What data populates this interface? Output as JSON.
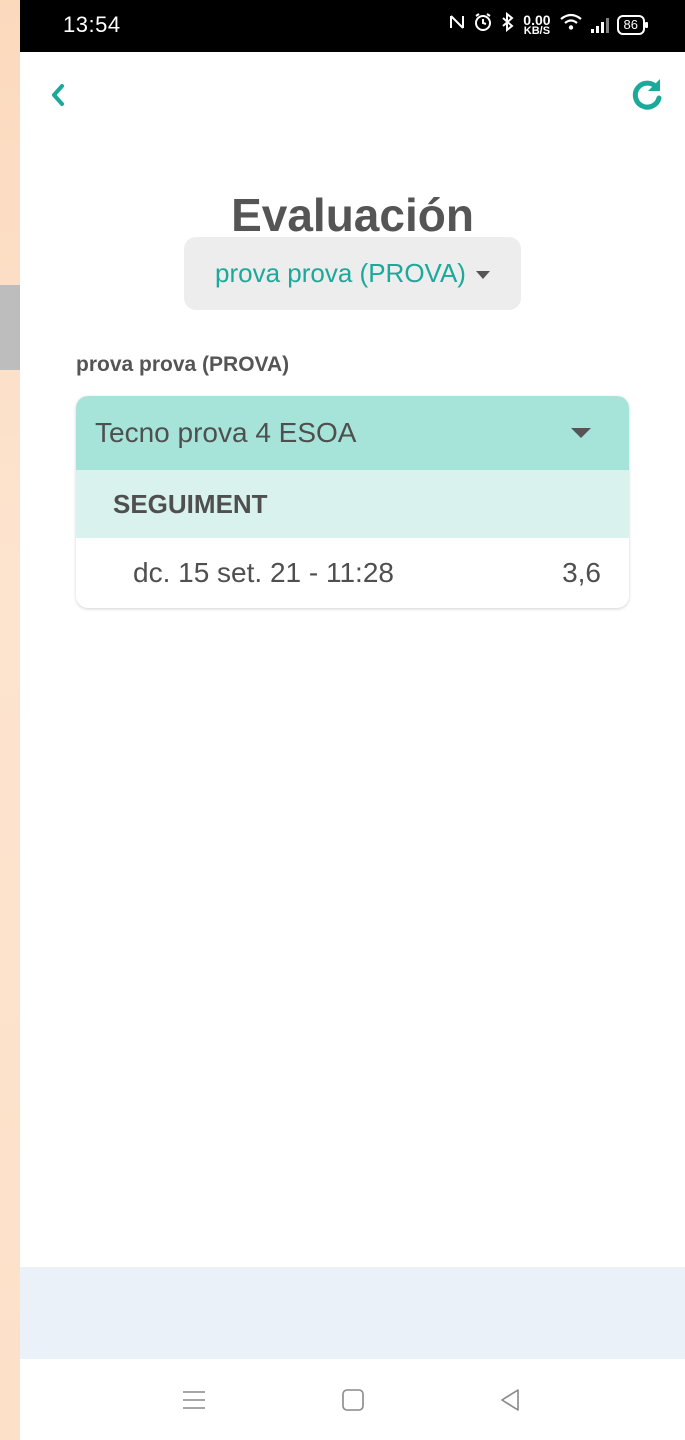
{
  "status_bar": {
    "time": "13:54",
    "icons": [
      "nfc-icon",
      "alarm-icon",
      "bluetooth-icon",
      "network-speed",
      "wifi-icon",
      "signal-icon",
      "battery-icon"
    ],
    "speed_value": "0.00",
    "speed_unit": "KB/S",
    "battery": "86"
  },
  "header": {
    "back_icon": "chevron-left-icon",
    "refresh_icon": "refresh-icon",
    "title": "Evaluación"
  },
  "student_selector": {
    "selected": "prova prova (PROVA)"
  },
  "student_label": "prova prova (PROVA)",
  "subject_card": {
    "subject": "Tecno prova 4 ESOA",
    "section": "SEGUIMENT",
    "grades": [
      {
        "date": "dc. 15 set. 21 - 11:28",
        "value": "3,6"
      }
    ]
  },
  "colors": {
    "accent": "#1aa99a",
    "subject_bg": "#a6e4da",
    "section_bg": "#d9f2ee",
    "text": "#555555"
  }
}
